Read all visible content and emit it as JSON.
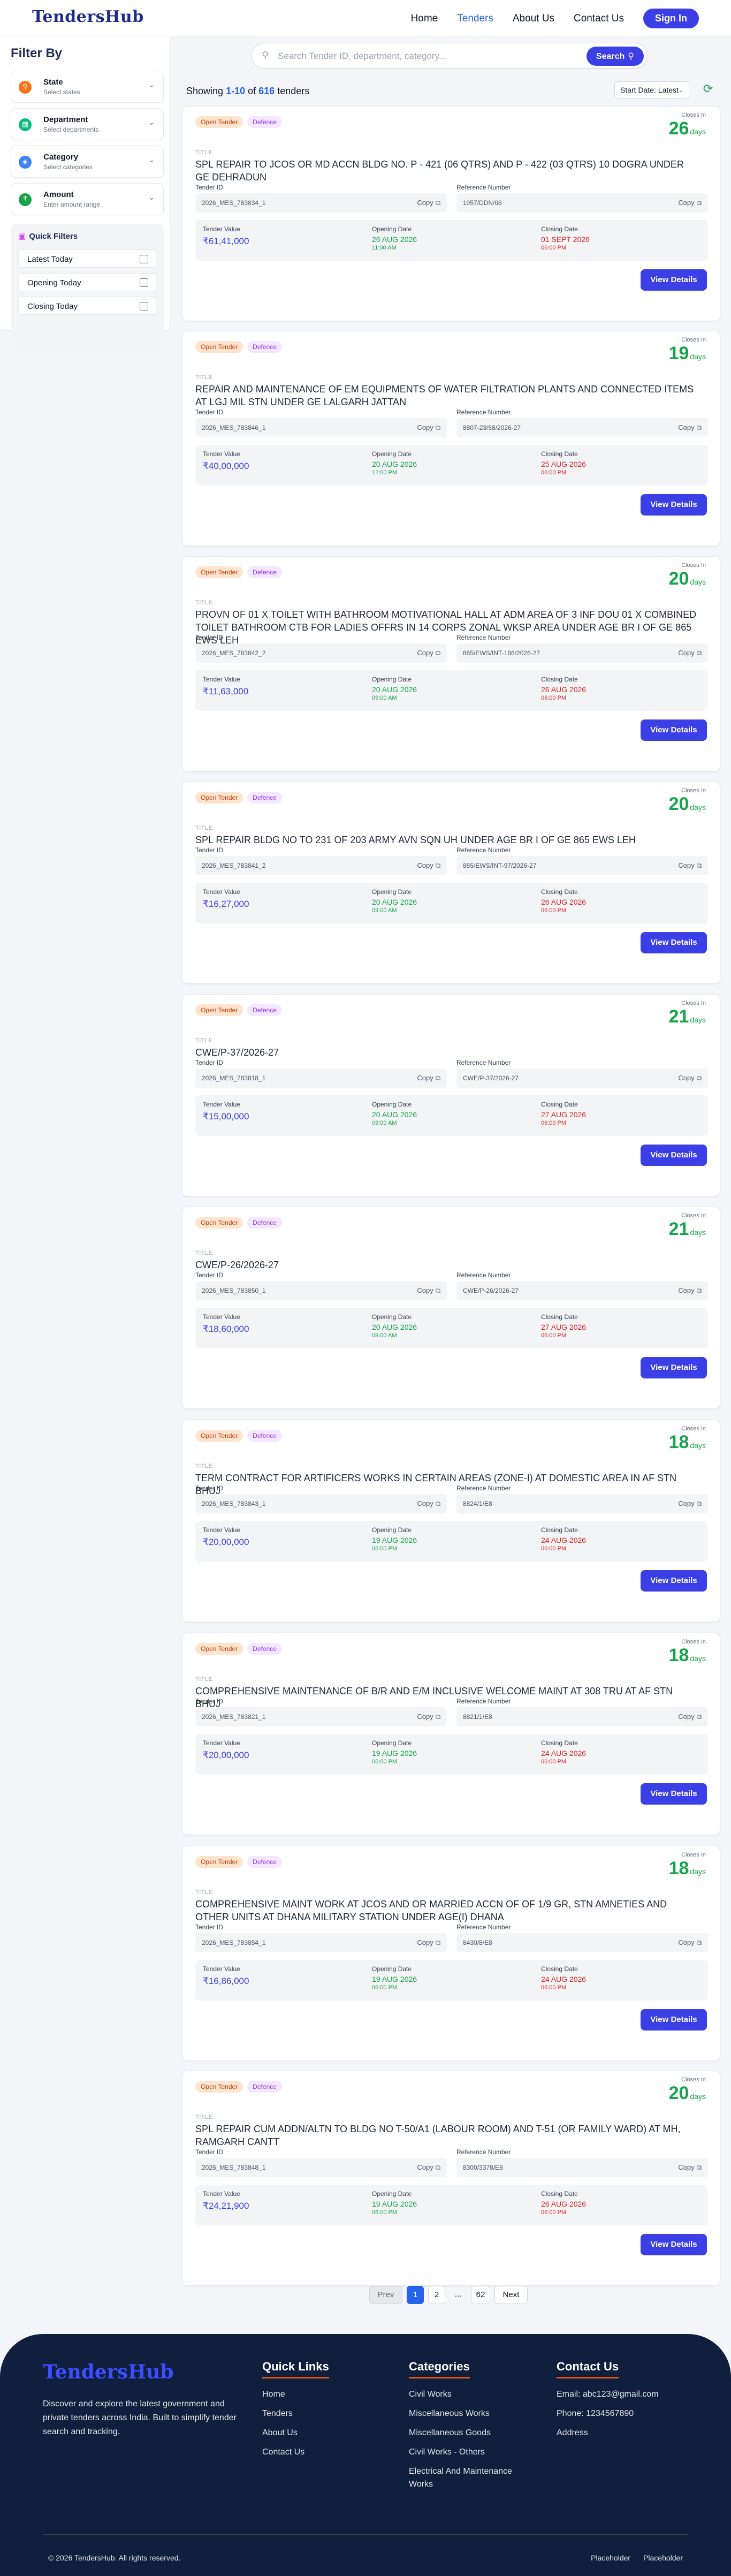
{
  "header": {
    "logo": "TendersHub",
    "nav": [
      {
        "label": "Home"
      },
      {
        "label": "Tenders"
      },
      {
        "label": "About Us"
      },
      {
        "label": "Contact Us"
      }
    ],
    "signin_label": "Sign In"
  },
  "sidebar": {
    "title": "Filter By",
    "filters": [
      {
        "title": "State",
        "subtitle": "Select states",
        "icon": "location-icon",
        "color": "#f97316"
      },
      {
        "title": "Department",
        "subtitle": "Select departments",
        "icon": "building-icon",
        "color": "#10b981"
      },
      {
        "title": "Category",
        "subtitle": "Select categories",
        "icon": "tag-icon",
        "color": "#3b82f6"
      },
      {
        "title": "Amount",
        "subtitle": "Enter amount range",
        "icon": "rupee-icon",
        "color": "#16a34a"
      }
    ],
    "quick_filters": {
      "title": "Quick Filters",
      "items": [
        {
          "label": "Latest Today"
        },
        {
          "label": "Opening Today"
        },
        {
          "label": "Closing Today"
        }
      ]
    }
  },
  "search": {
    "placeholder": "Search Tender ID, department, category...",
    "button_label": "Search"
  },
  "results": {
    "prefix": "Showing",
    "range": "1-10",
    "of": "of",
    "total": "616",
    "suffix": "tenders"
  },
  "sort": {
    "selected": "Start Date: Latest"
  },
  "labels": {
    "title": "TITLE",
    "tender_id": "Tender ID",
    "ref_number": "Reference Number",
    "tender_value": "Tender Value",
    "opening_date": "Opening Date",
    "closing_date": "Closing Date",
    "closes_in": "Closes In",
    "days": "days",
    "copy": "Copy",
    "view_details": "View Details",
    "badge_open": "Open Tender",
    "badge_cat": "Defence"
  },
  "tenders": [
    {
      "days": "26",
      "title": "SPL REPAIR TO JCOs OR MD ACCN BLDG NO. P - 421 (06 Qtrs) AND P - 422 (03 Qtrs) 10 DOGRA UNDER GE DEHRADUN",
      "tender_id": "2026_MES_783834_1",
      "ref": "1057/DDN/08",
      "value": "₹61,41,000",
      "open_date": "26 AUG 2026",
      "open_time": "11:00 AM",
      "close_date": "01 SEPT 2026",
      "close_time": "06:00 PM"
    },
    {
      "days": "19",
      "title": "REPAIR AND MAINTENANCE OF EM EQUIPMENTS OF WATER FILTRATION PLANTS AND CONNECTED ITEMS AT LGJ MIL STN UNDER GE LALGARH JATTAN",
      "tender_id": "2026_MES_783846_1",
      "ref": "8807-23/58/2026-27",
      "value": "₹40,00,000",
      "open_date": "20 AUG 2026",
      "open_time": "12:00 PM",
      "close_date": "25 AUG 2026",
      "close_time": "06:00 PM"
    },
    {
      "days": "20",
      "title": "PROVN OF 01 X TOILET WITH BATHROOM MOTIVATIONAL HALL AT ADM AREA OF 3 INF DOU 01 X COMBINED TOILET BATHROOM CTB FOR LADIES OFFRS IN 14 CORPS ZONAL WKSP AREA UNDER AGE BR I OF GE 865 EWS LEH",
      "tender_id": "2026_MES_783842_2",
      "ref": "865/EWS/INT-186/2026-27",
      "value": "₹11,63,000",
      "open_date": "20 AUG 2026",
      "open_time": "09:00 AM",
      "close_date": "26 AUG 2026",
      "close_time": "06:00 PM"
    },
    {
      "days": "20",
      "title": "SPL REPAIR BLDG NO TO 231 OF 203 ARMY AVN SQN UH UNDER AGE BR I OF GE 865 EWS LEH",
      "tender_id": "2026_MES_783841_2",
      "ref": "865/EWS/INT-97/2026-27",
      "value": "₹16,27,000",
      "open_date": "20 AUG 2026",
      "open_time": "09:00 AM",
      "close_date": "26 AUG 2026",
      "close_time": "06:00 PM"
    },
    {
      "days": "21",
      "title": "CWE/P-37/2026-27",
      "tender_id": "2026_MES_783818_1",
      "ref": "CWE/P-37/2026-27",
      "value": "₹15,00,000",
      "open_date": "20 AUG 2026",
      "open_time": "09:00 AM",
      "close_date": "27 AUG 2026",
      "close_time": "06:00 PM"
    },
    {
      "days": "21",
      "title": "CWE/P-26/2026-27",
      "tender_id": "2026_MES_783850_1",
      "ref": "CWE/P-26/2026-27",
      "value": "₹18,60,000",
      "open_date": "20 AUG 2026",
      "open_time": "09:00 AM",
      "close_date": "27 AUG 2026",
      "close_time": "06:00 PM"
    },
    {
      "days": "18",
      "title": "TERM CONTRACT FOR ARTIFICERS WORKS IN CERTAIN AREAS (ZONE-I) AT DOMESTIC AREA IN AF STN BHUJ",
      "tender_id": "2026_MES_783843_1",
      "ref": "8824/1/E8",
      "value": "₹20,00,000",
      "open_date": "19 AUG 2026",
      "open_time": "06:00 PM",
      "close_date": "24 AUG 2026",
      "close_time": "06:00 PM"
    },
    {
      "days": "18",
      "title": "COMPREHENSIVE MAINTENANCE OF B/R AND E/M INCLUSIVE WELCOME MAINT AT 308 TRU AT AF STN BHUJ",
      "tender_id": "2026_MES_783821_1",
      "ref": "8821/1/E8",
      "value": "₹20,00,000",
      "open_date": "19 AUG 2026",
      "open_time": "06:00 PM",
      "close_date": "24 AUG 2026",
      "close_time": "06:00 PM"
    },
    {
      "days": "18",
      "title": "COMPREHENSIVE MAINT WORK AT JCOs AND OR MARRIED ACCN OF OF 1/9 GR, STN AMNETIES AND OTHER UNITS AT DHANA MILITARY STATION UNDER AGE(I) DHANA",
      "tender_id": "2026_MES_783854_1",
      "ref": "8430/8/E8",
      "value": "₹16,86,000",
      "open_date": "19 AUG 2026",
      "open_time": "06:00 PM",
      "close_date": "24 AUG 2026",
      "close_time": "06:00 PM"
    },
    {
      "days": "20",
      "title": "SPL REPAIR CUM ADDN/ALTN TO BLDG NO T-50/A1 (LABOUR ROOM) AND T-51 (OR FAMILY WARD) AT MH, RAMGARH CANTT",
      "tender_id": "2026_MES_783848_1",
      "ref": "8300/3378/E8",
      "value": "₹24,21,900",
      "open_date": "19 AUG 2026",
      "open_time": "06:00 PM",
      "close_date": "26 AUG 2026",
      "close_time": "06:00 PM"
    }
  ],
  "pagination": {
    "prev": "Prev",
    "pages": [
      "1",
      "2",
      "...",
      "62"
    ],
    "next": "Next"
  },
  "footer": {
    "logo": "TendersHub",
    "description": "Discover and explore the latest government and private tenders across India. Built to simplify tender search and tracking.",
    "quick_links": {
      "title": "Quick Links",
      "items": [
        "Home",
        "Tenders",
        "About Us",
        "Contact Us"
      ]
    },
    "categories": {
      "title": "Categories",
      "items": [
        "Civil Works",
        "Miscellaneous Works",
        "Miscellaneous Goods",
        "Civil Works - Others",
        "Electrical And Maintenance Works"
      ]
    },
    "contact": {
      "title": "Contact Us",
      "email": "Email: abc123@gmail.com",
      "phone": "Phone: 1234567890",
      "address": "Address"
    },
    "copyright": "© 2026 TendersHub. All rights reserved.",
    "right_links": [
      "Placeholder",
      "Placeholder"
    ]
  }
}
